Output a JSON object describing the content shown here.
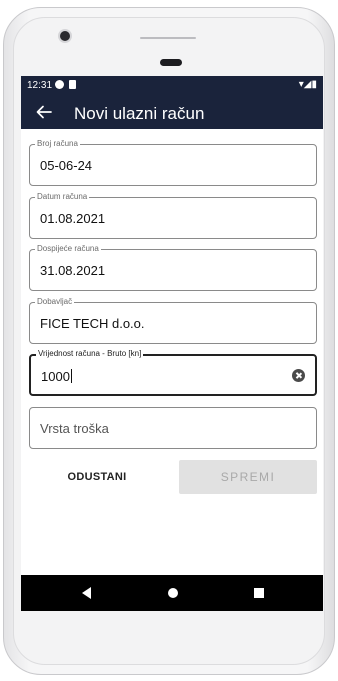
{
  "status_bar": {
    "time": "12:31",
    "right_icons": "▾◢▮"
  },
  "app_bar": {
    "title": "Novi ulazni račun"
  },
  "form": {
    "invoice_number": {
      "label": "Broj računa",
      "value": "05-06-24"
    },
    "invoice_date": {
      "label": "Datum računa",
      "value": "01.08.2021"
    },
    "due_date": {
      "label": "Dospijeće računa",
      "value": "31.08.2021"
    },
    "supplier": {
      "label": "Dobavljač",
      "value": "FICE TECH d.o.o."
    },
    "gross_amount": {
      "label": "Vrijednost računa - Bruto [kn]",
      "value": "1000"
    },
    "expense_type": {
      "placeholder": "Vrsta troška"
    }
  },
  "actions": {
    "cancel_label": "ODUSTANI",
    "save_label": "SPREMI"
  },
  "colors": {
    "app_bar": "#1a233b",
    "disabled_button": "#e1e1e1"
  }
}
